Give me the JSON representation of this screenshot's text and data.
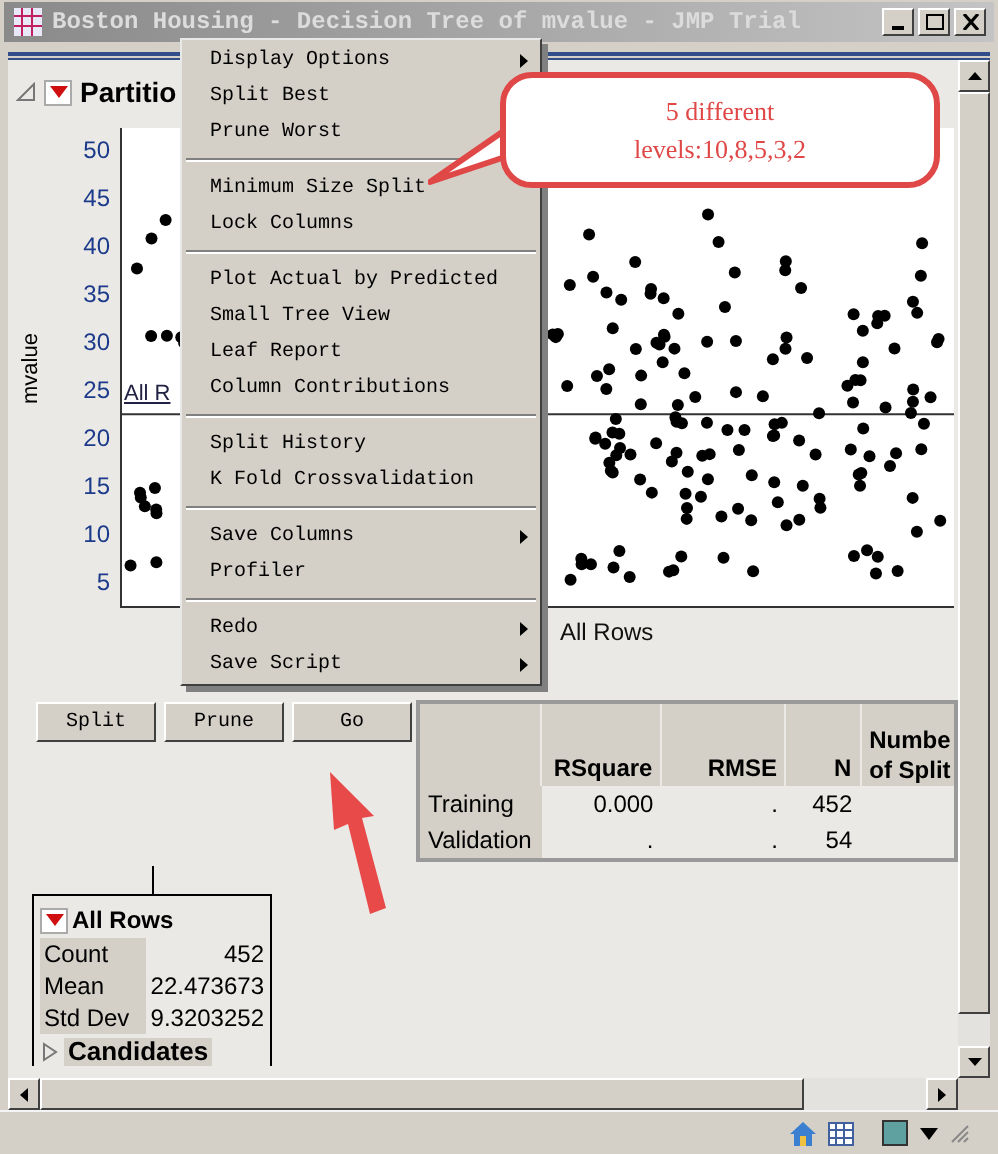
{
  "window": {
    "title": "Boston Housing - Decision Tree of mvalue - JMP Trial"
  },
  "report": {
    "title": "Partitio",
    "expanded": true
  },
  "plot": {
    "y_label": "mvalue",
    "y_ticks": [
      "50",
      "45",
      "40",
      "35",
      "30",
      "25",
      "20",
      "15",
      "10",
      "5"
    ],
    "cut_label": "All R",
    "node_label": "All Rows"
  },
  "buttons": [
    "Split",
    "Prune",
    "Go"
  ],
  "fit_table": {
    "columns": [
      "RSquare",
      "RMSE",
      "N"
    ],
    "cut_column": [
      "Numbe",
      "of Split"
    ],
    "rows": [
      {
        "label": "Training",
        "cells": [
          "0.000",
          ".",
          "452"
        ]
      },
      {
        "label": "Validation",
        "cells": [
          ".",
          ".",
          "54"
        ]
      }
    ]
  },
  "node": {
    "title": "All Rows",
    "stats": [
      {
        "label": "Count",
        "value": "452"
      },
      {
        "label": "Mean",
        "value": "22.473673"
      },
      {
        "label": "Std Dev",
        "value": "9.3203252"
      }
    ],
    "candidates": {
      "label": "Candidates",
      "expanded": false
    }
  },
  "menu": {
    "groups": [
      [
        {
          "label": "Display Options",
          "submenu": true
        },
        {
          "label": "Split Best"
        },
        {
          "label": "Prune Worst"
        }
      ],
      [
        {
          "label": "Minimum Size Split",
          "submenu": false
        },
        {
          "label": "Lock Columns",
          "submenu": false
        }
      ],
      [
        {
          "label": "Plot Actual by Predicted",
          "submenu": false
        },
        {
          "label": "Small Tree View",
          "submenu": false
        },
        {
          "label": "Leaf Report",
          "submenu": false
        },
        {
          "label": "Column Contributions",
          "submenu": false
        }
      ],
      [
        {
          "label": "Split History",
          "submenu": false
        },
        {
          "label": "K Fold Crossvalidation",
          "submenu": false
        }
      ],
      [
        {
          "label": "Save Columns",
          "submenu": true
        },
        {
          "label": "Profiler",
          "submenu": false
        }
      ],
      [
        {
          "label": "Redo",
          "submenu": true
        },
        {
          "label": "Save Script",
          "submenu": true
        }
      ]
    ]
  },
  "callout": {
    "lines": [
      "5 different",
      "levels:10,8,5,3,2"
    ]
  }
}
